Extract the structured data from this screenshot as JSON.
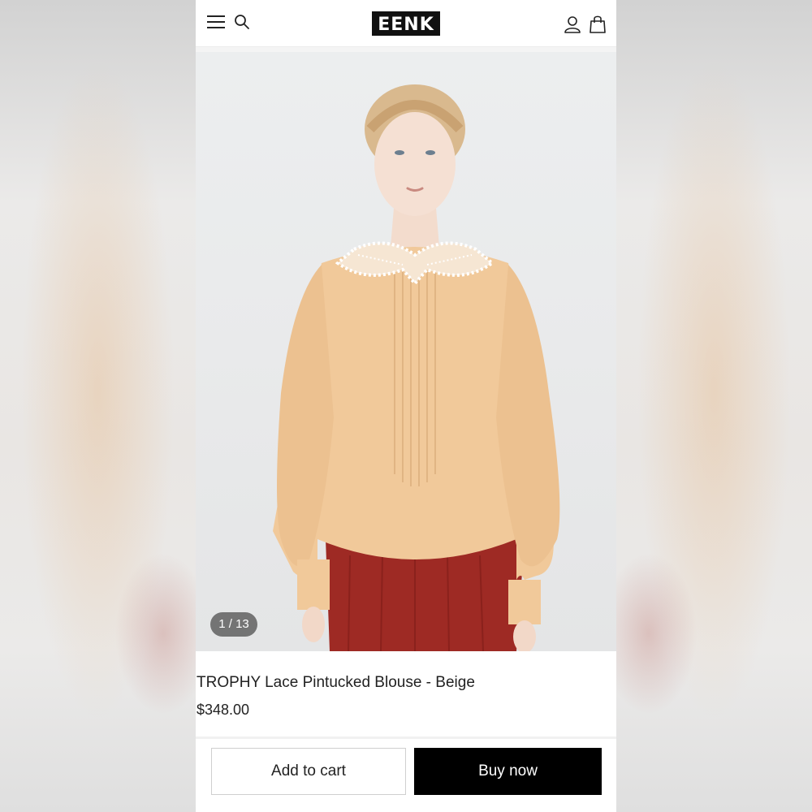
{
  "header": {
    "logo_text": "EENK",
    "icons": [
      "menu-icon",
      "search-icon",
      "user-icon",
      "shopping-bag-icon"
    ]
  },
  "gallery": {
    "counter": "1 / 13",
    "image_alt": "Model wearing beige lace collar pintucked blouse with red skirt"
  },
  "product": {
    "title": "TROPHY Lace Pintucked Blouse - Beige",
    "price": "$348.00"
  },
  "actions": {
    "add_to_cart_label": "Add to cart",
    "buy_now_label": "Buy now"
  },
  "colors": {
    "accent": "#000000",
    "blouse": "#f1c99a",
    "skirt": "#a02a24",
    "background": "#ffffff"
  }
}
